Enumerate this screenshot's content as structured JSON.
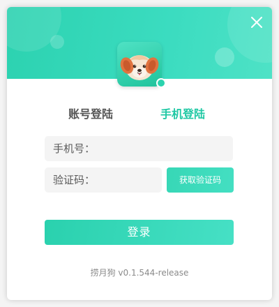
{
  "colors": {
    "accent": "#2bd3ae",
    "active_tab": "#1fc8a4",
    "inactive_tab": "#555555",
    "input_bg": "#f4f4f4"
  },
  "header": {
    "close_icon": "close-icon",
    "avatar_icon": "puppy-logo-icon"
  },
  "tabs": [
    {
      "label": "账号登陆",
      "active": false
    },
    {
      "label": "手机登陆",
      "active": true
    }
  ],
  "form": {
    "phone_placeholder": "手机号：",
    "phone_value": "",
    "code_placeholder": "验证码：",
    "code_value": "",
    "get_code_label": "获取验证码",
    "login_label": "登录"
  },
  "footer": {
    "version": "捞月狗 v0.1.544-release"
  }
}
